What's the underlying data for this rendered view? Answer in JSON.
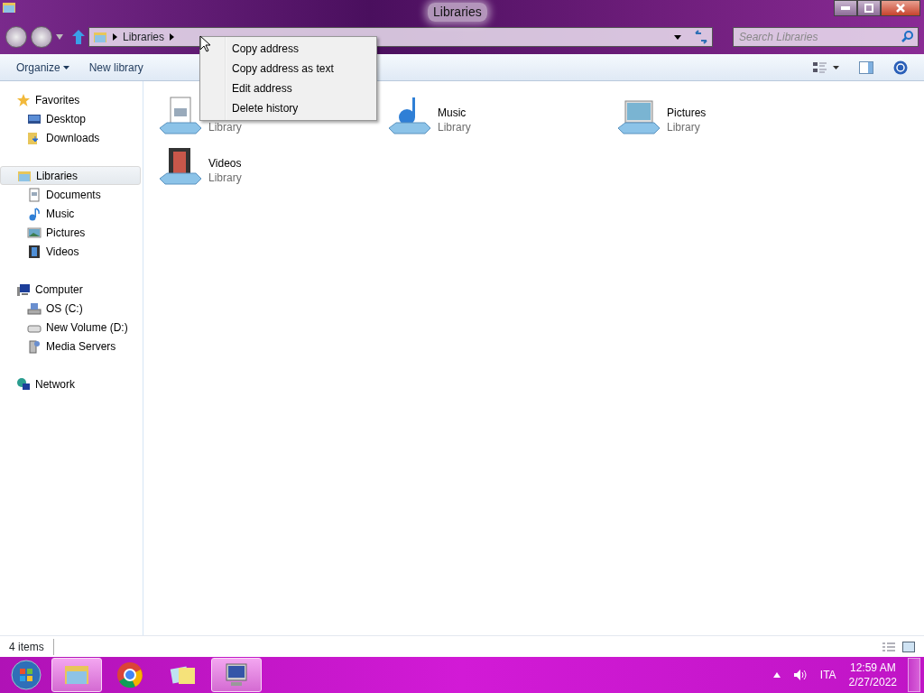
{
  "window": {
    "title": "Libraries"
  },
  "address_bar": {
    "segments": [
      "Libraries"
    ]
  },
  "search": {
    "placeholder": "Search Libraries"
  },
  "toolbar": {
    "buttons": [
      {
        "label": "Organize",
        "dropdown": true
      },
      {
        "label": "New library",
        "dropdown": false
      }
    ]
  },
  "context_menu": {
    "items": [
      "Copy address",
      "Copy address as text",
      "Edit address",
      "Delete history"
    ]
  },
  "sidebar": {
    "groups": [
      {
        "label": "Favorites",
        "selected": false,
        "children": [
          {
            "label": "Desktop"
          },
          {
            "label": "Downloads"
          }
        ]
      },
      {
        "label": "Libraries",
        "selected": true,
        "children": [
          {
            "label": "Documents"
          },
          {
            "label": "Music"
          },
          {
            "label": "Pictures"
          },
          {
            "label": "Videos"
          }
        ]
      },
      {
        "label": "Computer",
        "selected": false,
        "children": [
          {
            "label": "OS (C:)"
          },
          {
            "label": "New Volume (D:)"
          },
          {
            "label": "Media Servers"
          }
        ]
      },
      {
        "label": "Network",
        "selected": false
      }
    ]
  },
  "libraries": [
    {
      "subtitle": "Library"
    },
    {
      "name": "Music",
      "subtitle": "Library"
    },
    {
      "name": "Pictures",
      "subtitle": "Library"
    },
    {
      "name": "Videos",
      "subtitle": "Library"
    }
  ],
  "status_bar": {
    "count": "4 items"
  },
  "taskbar": {
    "apps": [
      {
        "active": true
      },
      {
        "active": false
      },
      {
        "active": false
      },
      {
        "active": true
      }
    ],
    "language": "ITA",
    "time": "12:59 AM",
    "date": "2/27/2022"
  }
}
